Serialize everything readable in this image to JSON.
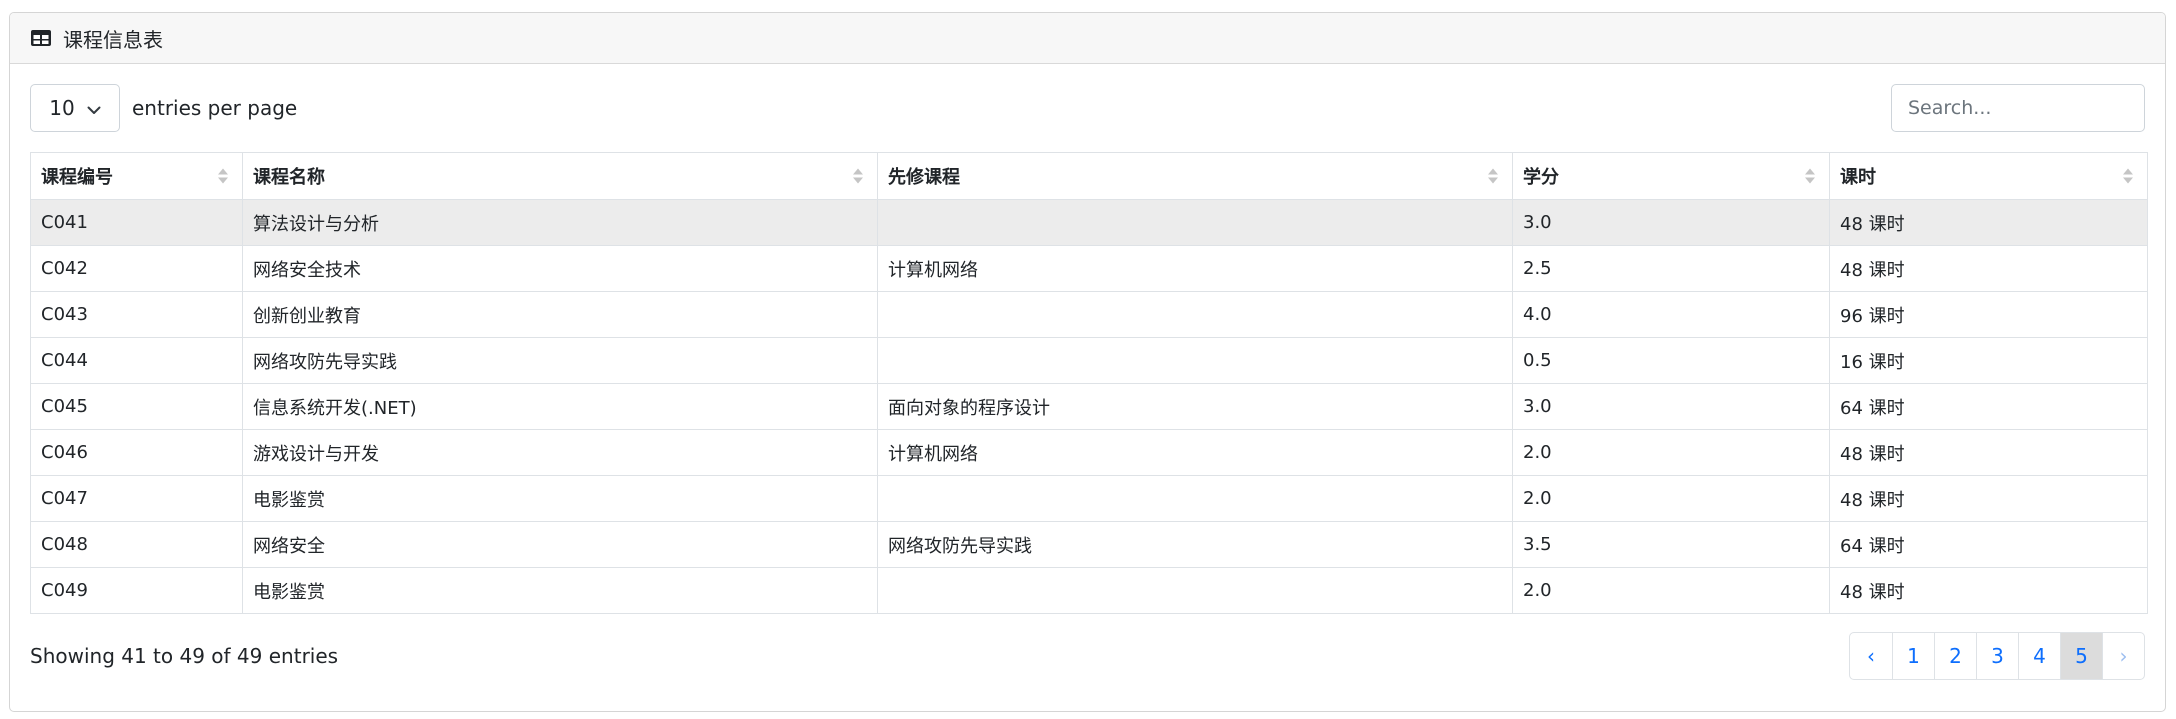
{
  "header": {
    "title": "课程信息表",
    "icon": "table-icon"
  },
  "length": {
    "value": "10",
    "label": "entries per page"
  },
  "search": {
    "placeholder": "Search..."
  },
  "table": {
    "columns": [
      "课程编号",
      "课程名称",
      "先修课程",
      "学分",
      "课时"
    ],
    "rows": [
      [
        "C041",
        "算法设计与分析",
        "",
        "3.0",
        "48 课时"
      ],
      [
        "C042",
        "网络安全技术",
        "计算机网络",
        "2.5",
        "48 课时"
      ],
      [
        "C043",
        "创新创业教育",
        "",
        "4.0",
        "96 课时"
      ],
      [
        "C044",
        "网络攻防先导实践",
        "",
        "0.5",
        "16 课时"
      ],
      [
        "C045",
        "信息系统开发(.NET)",
        "面向对象的程序设计",
        "3.0",
        "64 课时"
      ],
      [
        "C046",
        "游戏设计与开发",
        "计算机网络",
        "2.0",
        "48 课时"
      ],
      [
        "C047",
        "电影鉴赏",
        "",
        "2.0",
        "48 课时"
      ],
      [
        "C048",
        "网络安全",
        "网络攻防先导实践",
        "3.5",
        "64 课时"
      ],
      [
        "C049",
        "电影鉴赏",
        "",
        "2.0",
        "48 课时"
      ]
    ]
  },
  "footer": {
    "info": "Showing 41 to 49 of 49 entries"
  },
  "pagination": {
    "prev": "‹",
    "pages": [
      "1",
      "2",
      "3",
      "4",
      "5"
    ],
    "current": "5",
    "next": "›"
  },
  "colors": {
    "link": "#0d6efd",
    "active_row": "#ececec",
    "current_page": "#dcdcdc"
  }
}
